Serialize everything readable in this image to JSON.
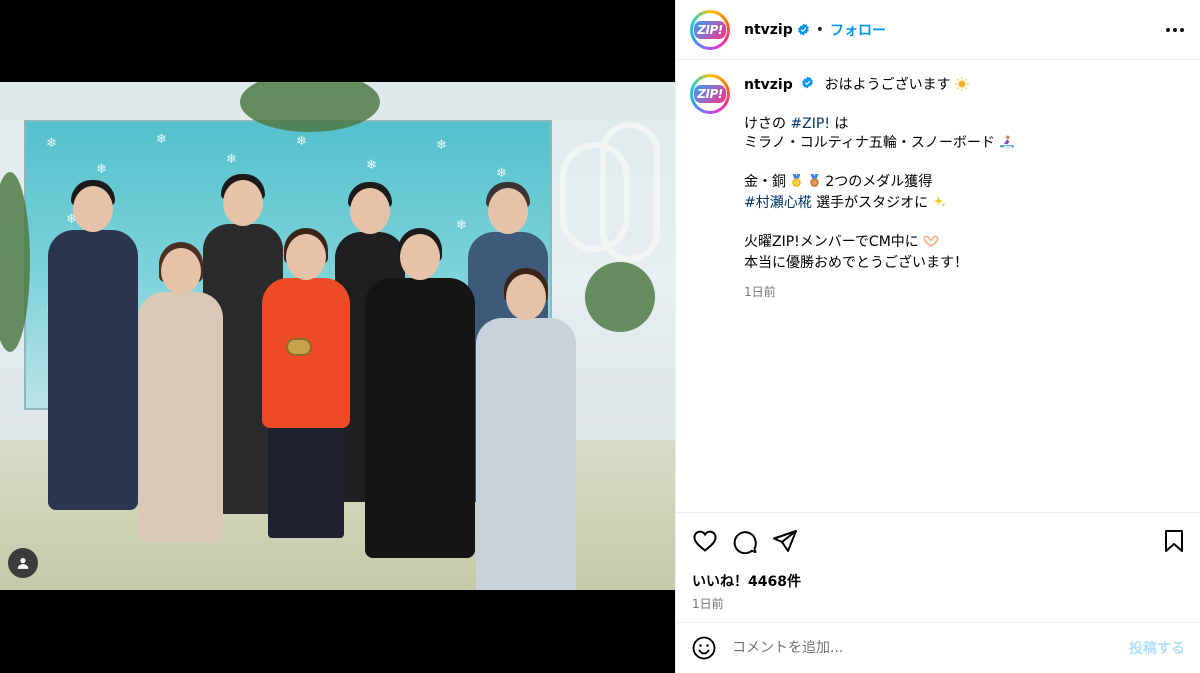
{
  "account": {
    "username": "ntvzip",
    "avatar_logo_text": "ZIP!",
    "verified_icon": "verified-badge-icon",
    "separator": "•",
    "follow_label": "フォロー"
  },
  "caption": {
    "greeting": "おはようございます",
    "line1_prefix": "けさの ",
    "line1_hashtag": "#ZIP!",
    "line1_suffix": " は",
    "line2": "ミラノ・コルティナ五輪・スノーボード",
    "line3": "金・銅",
    "line3_suffix": "2つのメダル獲得",
    "line4_hashtag": "#村瀬心椛",
    "line4_suffix": " 選手がスタジオに",
    "line5": "火曜ZIP!メンバーでCM中に",
    "line6": "本当に優勝おめでとうございます！",
    "time": "1日前"
  },
  "stats": {
    "likes": "いいね！4468件",
    "time": "1日前"
  },
  "comment": {
    "placeholder": "コメントを追加...",
    "post_label": "投稿する"
  },
  "colors": {
    "accent": "#0095f6",
    "post_disabled": "#b2dffc",
    "meta_gray": "#737373",
    "hashtag": "#00376b"
  }
}
